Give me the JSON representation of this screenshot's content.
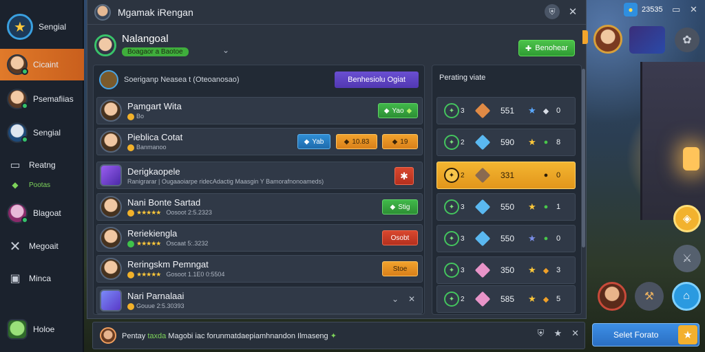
{
  "window": {
    "title": "Mgamak iRengan"
  },
  "sidebar": {
    "items": [
      {
        "label": "Sengial",
        "icon": "star-badge-icon"
      },
      {
        "label": "Cicaint",
        "icon": "avatar"
      },
      {
        "label": "Psemafiias",
        "icon": "avatar"
      },
      {
        "label": "Sengial",
        "icon": "avatar"
      },
      {
        "label": "Reatng",
        "icon": "book-icon"
      },
      {
        "label": "Pootas",
        "icon": "map-icon"
      },
      {
        "label": "Blagoat",
        "icon": "avatar"
      },
      {
        "label": "Megoait",
        "icon": "cross-icon"
      },
      {
        "label": "Minca",
        "icon": "square-icon"
      },
      {
        "label": "Holoe",
        "icon": "dragon-icon"
      }
    ]
  },
  "profile": {
    "name": "Nalangoal",
    "subtitle": "Boagaor a Baotoe"
  },
  "header_button": "Benohear",
  "list": {
    "heading": "Soeriganp Neasea t (Oteoanosao)",
    "action_button": "Benhesiolu Ogiat",
    "rows": [
      {
        "name": "Pamgart Wita",
        "sub": "Bo",
        "button": "Yao",
        "button_color": "green"
      },
      {
        "name": "Pieblica Cotat",
        "sub": "Banmanoo",
        "buttons": [
          "Yab",
          "10.83",
          "19"
        ],
        "button_colors": [
          "blue",
          "orange",
          "orange"
        ]
      },
      {
        "name": "Derigkaopele",
        "sub": "Ranigrarar | Ougaaoiarpe ridecAdactig Maasgin Y Bamorafnonoameds)",
        "button_icon": "puzzle-icon",
        "button_color": "red"
      },
      {
        "name": "Nani Bonte Sartad",
        "sub": "Oosoot 2:5.2323",
        "stars": "★★★★★",
        "button": "Stig",
        "button_color": "green"
      },
      {
        "name": "Reriekiengla",
        "sub": "Oscaat 5:.3232",
        "stars": "★★★★★",
        "button": "Osobt",
        "button_color": "red"
      },
      {
        "name": "Reringskm Pemngat",
        "sub": "Gosoot 1.1E0 0:5504",
        "stars": "★★★★★",
        "button": "Stoe",
        "button_color": "orange"
      },
      {
        "name": "Nari Parnalaai",
        "sub": "Gouue 2:5.30393"
      }
    ]
  },
  "side_panel": {
    "title": "Perating viate",
    "rows": [
      {
        "num": "3",
        "value": "551",
        "end": "0",
        "cube_color": "#e08a45",
        "star_color": "#5aa8ff",
        "dot": "◆",
        "dot_color": "#d8dde6",
        "highlight": false
      },
      {
        "num": "2",
        "value": "590",
        "end": "8",
        "cube_color": "#5ab8f0",
        "star_color": "#ffc83a",
        "dot": "●",
        "dot_color": "#48c84a",
        "highlight": false
      },
      {
        "num": "2",
        "value": "331",
        "end": "0",
        "cube_color": "#8a6a50",
        "star_color": "",
        "dot": "●",
        "dot_color": "#2a1c08",
        "highlight": true
      },
      {
        "num": "3",
        "value": "550",
        "end": "1",
        "cube_color": "#5ab8f0",
        "star_color": "#ffc83a",
        "dot": "●",
        "dot_color": "#48c84a",
        "highlight": false
      },
      {
        "num": "3",
        "value": "550",
        "end": "0",
        "cube_color": "#5ab8f0",
        "star_color": "#7a8ee8",
        "dot": "●",
        "dot_color": "#48c84a",
        "highlight": false
      },
      {
        "num": "3",
        "value": "350",
        "end": "3",
        "cube_color": "#e894c8",
        "star_color": "#ffc83a",
        "dot": "◆",
        "dot_color": "#f0a028",
        "highlight": false
      },
      {
        "num": "2",
        "value": "585",
        "end": "5",
        "cube_color": "#e894c8",
        "star_color": "#ffc83a",
        "dot": "◆",
        "dot_color": "#f0a028",
        "highlight": false
      }
    ]
  },
  "chat": {
    "prefix": "Pentay",
    "tag": "taxda",
    "message": "Magobi iac forunmatdaepiamhnandon Ilmaseng"
  },
  "hud": {
    "currency": "23535",
    "select_button": "Selet Forato"
  }
}
